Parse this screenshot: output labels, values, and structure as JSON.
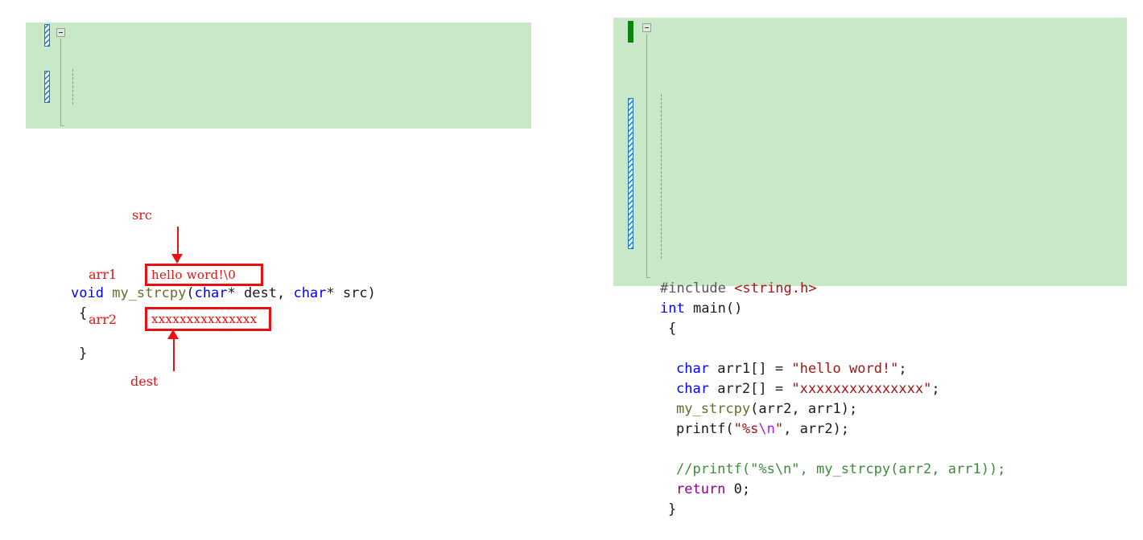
{
  "editor": {
    "background_color": "#c8e8c8",
    "saved_change_color": "#128012",
    "unsaved_change_color": "#1e78c8"
  },
  "code_block_left": {
    "name": "my_strcpy function definition",
    "lines": [
      {
        "tokens": [
          {
            "t": "void",
            "c": "kw"
          },
          {
            "t": " ",
            "c": "punct"
          },
          {
            "t": "my_strcpy",
            "c": "fn"
          },
          {
            "t": "(",
            "c": "punct"
          },
          {
            "t": "char",
            "c": "kw"
          },
          {
            "t": "* ",
            "c": "punct"
          },
          {
            "t": "dest",
            "c": "id"
          },
          {
            "t": ", ",
            "c": "punct"
          },
          {
            "t": "char",
            "c": "kw"
          },
          {
            "t": "* ",
            "c": "punct"
          },
          {
            "t": "src",
            "c": "id"
          },
          {
            "t": ")",
            "c": "punct"
          }
        ]
      },
      {
        "tokens": [
          {
            "t": "{",
            "c": "punct"
          }
        ],
        "indent": 1
      },
      {
        "tokens": [
          {
            "t": "",
            "c": "punct"
          }
        ],
        "indent": 1
      },
      {
        "tokens": [
          {
            "t": "}",
            "c": "punct"
          }
        ],
        "indent": 1
      }
    ]
  },
  "code_block_right": {
    "name": "main function",
    "lines": [
      {
        "tokens": [
          {
            "t": "#include ",
            "c": "pp"
          },
          {
            "t": "<string.h>",
            "c": "hdr"
          }
        ]
      },
      {
        "tokens": [
          {
            "t": "int",
            "c": "kw"
          },
          {
            "t": " ",
            "c": "punct"
          },
          {
            "t": "main",
            "c": "id"
          },
          {
            "t": "()",
            "c": "punct"
          }
        ]
      },
      {
        "tokens": [
          {
            "t": "{",
            "c": "punct"
          }
        ],
        "indent": 1
      },
      {
        "tokens": [
          {
            "t": "",
            "c": "punct"
          }
        ],
        "indent": 1
      },
      {
        "indent": 2,
        "tokens": [
          {
            "t": "char",
            "c": "kw"
          },
          {
            "t": " ",
            "c": "punct"
          },
          {
            "t": "arr1",
            "c": "id"
          },
          {
            "t": "[] = ",
            "c": "punct"
          },
          {
            "t": "\"hello word!\"",
            "c": "str"
          },
          {
            "t": ";",
            "c": "punct"
          }
        ]
      },
      {
        "indent": 2,
        "tokens": [
          {
            "t": "char",
            "c": "kw"
          },
          {
            "t": " ",
            "c": "punct"
          },
          {
            "t": "arr2",
            "c": "id"
          },
          {
            "t": "[] = ",
            "c": "punct"
          },
          {
            "t": "\"xxxxxxxxxxxxxxx\"",
            "c": "str"
          },
          {
            "t": ";",
            "c": "punct"
          }
        ]
      },
      {
        "indent": 2,
        "tokens": [
          {
            "t": "my_strcpy",
            "c": "fn"
          },
          {
            "t": "(",
            "c": "punct"
          },
          {
            "t": "arr2",
            "c": "id"
          },
          {
            "t": ", ",
            "c": "punct"
          },
          {
            "t": "arr1",
            "c": "id"
          },
          {
            "t": ");",
            "c": "punct"
          }
        ]
      },
      {
        "indent": 2,
        "tokens": [
          {
            "t": "printf",
            "c": "id"
          },
          {
            "t": "(",
            "c": "punct"
          },
          {
            "t": "\"%s",
            "c": "str"
          },
          {
            "t": "\\n",
            "c": "esc"
          },
          {
            "t": "\"",
            "c": "str"
          },
          {
            "t": ", ",
            "c": "punct"
          },
          {
            "t": "arr2",
            "c": "id"
          },
          {
            "t": ");",
            "c": "punct"
          }
        ]
      },
      {
        "tokens": [
          {
            "t": "",
            "c": "punct"
          }
        ],
        "indent": 2
      },
      {
        "indent": 2,
        "tokens": [
          {
            "t": "//printf(\"%s\\n\", my_strcpy(arr2, arr1));",
            "c": "cmt"
          }
        ]
      },
      {
        "indent": 2,
        "tokens": [
          {
            "t": "return",
            "c": "ctrl"
          },
          {
            "t": " ",
            "c": "punct"
          },
          {
            "t": "0",
            "c": "num"
          },
          {
            "t": ";",
            "c": "punct"
          }
        ]
      },
      {
        "tokens": [
          {
            "t": "}",
            "c": "punct"
          }
        ],
        "indent": 1
      }
    ]
  },
  "diagram": {
    "color": "#e81010",
    "src_label": "src",
    "dest_label": "dest",
    "arr1_label": "arr1",
    "arr2_label": "arr2",
    "arr1_value": "hello word!\\0",
    "arr2_value": "xxxxxxxxxxxxxxx"
  }
}
